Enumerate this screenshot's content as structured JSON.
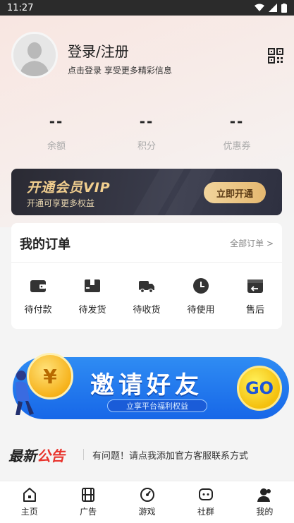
{
  "status_bar": {
    "time": "11:27"
  },
  "profile": {
    "login_title": "登录/注册",
    "login_subtitle": "点击登录 享受更多精彩信息"
  },
  "stats": [
    {
      "value": "--",
      "label": "余额"
    },
    {
      "value": "--",
      "label": "积分"
    },
    {
      "value": "--",
      "label": "优惠券"
    }
  ],
  "vip": {
    "title": "开通会员VIP",
    "subtitle": "开通可享更多权益",
    "button": "立即开通"
  },
  "orders": {
    "title": "我的订单",
    "all_link": "全部订单 >",
    "items": [
      {
        "label": "待付款",
        "icon": "wallet-icon"
      },
      {
        "label": "待发货",
        "icon": "box-icon"
      },
      {
        "label": "待收货",
        "icon": "truck-icon"
      },
      {
        "label": "待使用",
        "icon": "clock-icon"
      },
      {
        "label": "售后",
        "icon": "return-icon"
      }
    ]
  },
  "invite": {
    "title": "邀请好友",
    "subtitle": "立享平台福利权益",
    "go": "GO",
    "coin_symbol": "¥"
  },
  "notice": {
    "logo_part1": "最新",
    "logo_part2": "公告",
    "text": "有问题！请点我添加官方客服联系方式"
  },
  "tabbar": [
    {
      "label": "主页",
      "icon": "home-icon"
    },
    {
      "label": "广告",
      "icon": "film-icon"
    },
    {
      "label": "游戏",
      "icon": "gauge-icon"
    },
    {
      "label": "社群",
      "icon": "chat-icon"
    },
    {
      "label": "我的",
      "icon": "user-icon"
    }
  ],
  "colors": {
    "vip_gold": "#f2cf8f",
    "invite_blue": "#1767e8",
    "notice_red": "#e8342d"
  }
}
